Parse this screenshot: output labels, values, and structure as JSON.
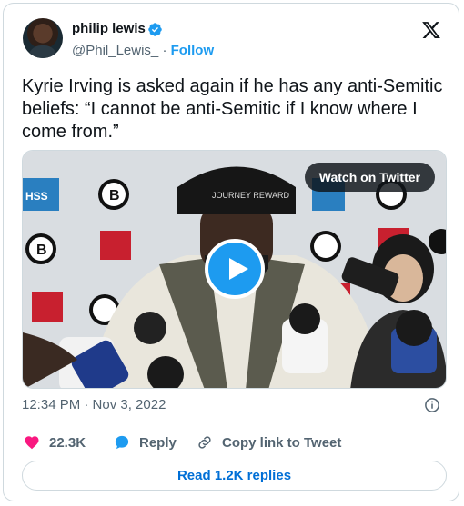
{
  "author": {
    "name": "philip lewis",
    "handle": "@Phil_Lewis_",
    "separator": "·",
    "follow_label": "Follow"
  },
  "tweet": {
    "text": "Kyrie Irving is asked again if he has any anti-Semitic beliefs: “I cannot be anti-Semitic if I know where I come from.”"
  },
  "media": {
    "watch_label": "Watch on Twitter",
    "backdrop_logos": [
      "HSS",
      "BIO STEEL"
    ],
    "cap_text": "JOURNEY REWARD"
  },
  "meta": {
    "timestamp": "12:34 PM · Nov 3, 2022"
  },
  "actions": {
    "likes": "22.3K",
    "reply_label": "Reply",
    "copy_label": "Copy link to Tweet"
  },
  "read_replies_label": "Read 1.2K replies",
  "colors": {
    "accent": "#1d9bf0",
    "heart": "#f91880",
    "link": "#006fd6",
    "muted": "#536471"
  }
}
